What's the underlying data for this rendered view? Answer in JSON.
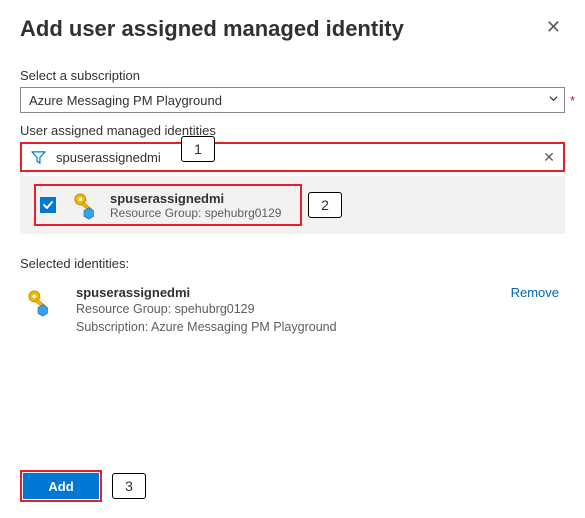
{
  "header": {
    "title": "Add user assigned managed identity"
  },
  "subscription": {
    "label": "Select a subscription",
    "value": "Azure Messaging PM Playground"
  },
  "filter": {
    "label": "User assigned managed identities",
    "value": "spuserassignedmi"
  },
  "result": {
    "name": "spuserassignedmi",
    "resource_group_line": "Resource Group: spehubrg0129"
  },
  "selected": {
    "section_label": "Selected identities:",
    "name": "spuserassignedmi",
    "resource_group_line": "Resource Group: spehubrg0129",
    "subscription_line": "Subscription: Azure Messaging PM Playground",
    "remove_label": "Remove"
  },
  "footer": {
    "add_label": "Add"
  },
  "callouts": {
    "c1": "1",
    "c2": "2",
    "c3": "3"
  }
}
